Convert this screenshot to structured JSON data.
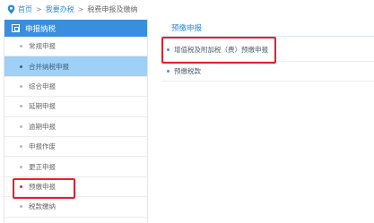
{
  "breadcrumb": {
    "home": "首页",
    "sep1": ">",
    "mine": "我要办税",
    "sep2": ">",
    "current": "税费申报及缴纳"
  },
  "sidebar": {
    "title": "申报纳税",
    "items": [
      {
        "label": "常规申报"
      },
      {
        "label": "合并纳税申报"
      },
      {
        "label": "综合申报"
      },
      {
        "label": "延期申报"
      },
      {
        "label": "逾期申报"
      },
      {
        "label": "申报作废"
      },
      {
        "label": "更正申报"
      },
      {
        "label": "预缴申报"
      },
      {
        "label": "税款缴纳"
      }
    ],
    "active_index": 1,
    "highlight_index": 7
  },
  "panel": {
    "tab_title": "预缴申报",
    "items": [
      {
        "label": "增值税及附加税（费）预缴申报"
      },
      {
        "label": "预缴税款"
      }
    ]
  },
  "colors": {
    "accent": "#3a8fdc",
    "active_bg": "#9fd0f6",
    "highlight_border": "#e5202e",
    "link": "#2a8ad6"
  },
  "icons": {
    "breadcrumb_pin": "location-pin-icon",
    "sidebar_header": "grid-square-icon"
  }
}
